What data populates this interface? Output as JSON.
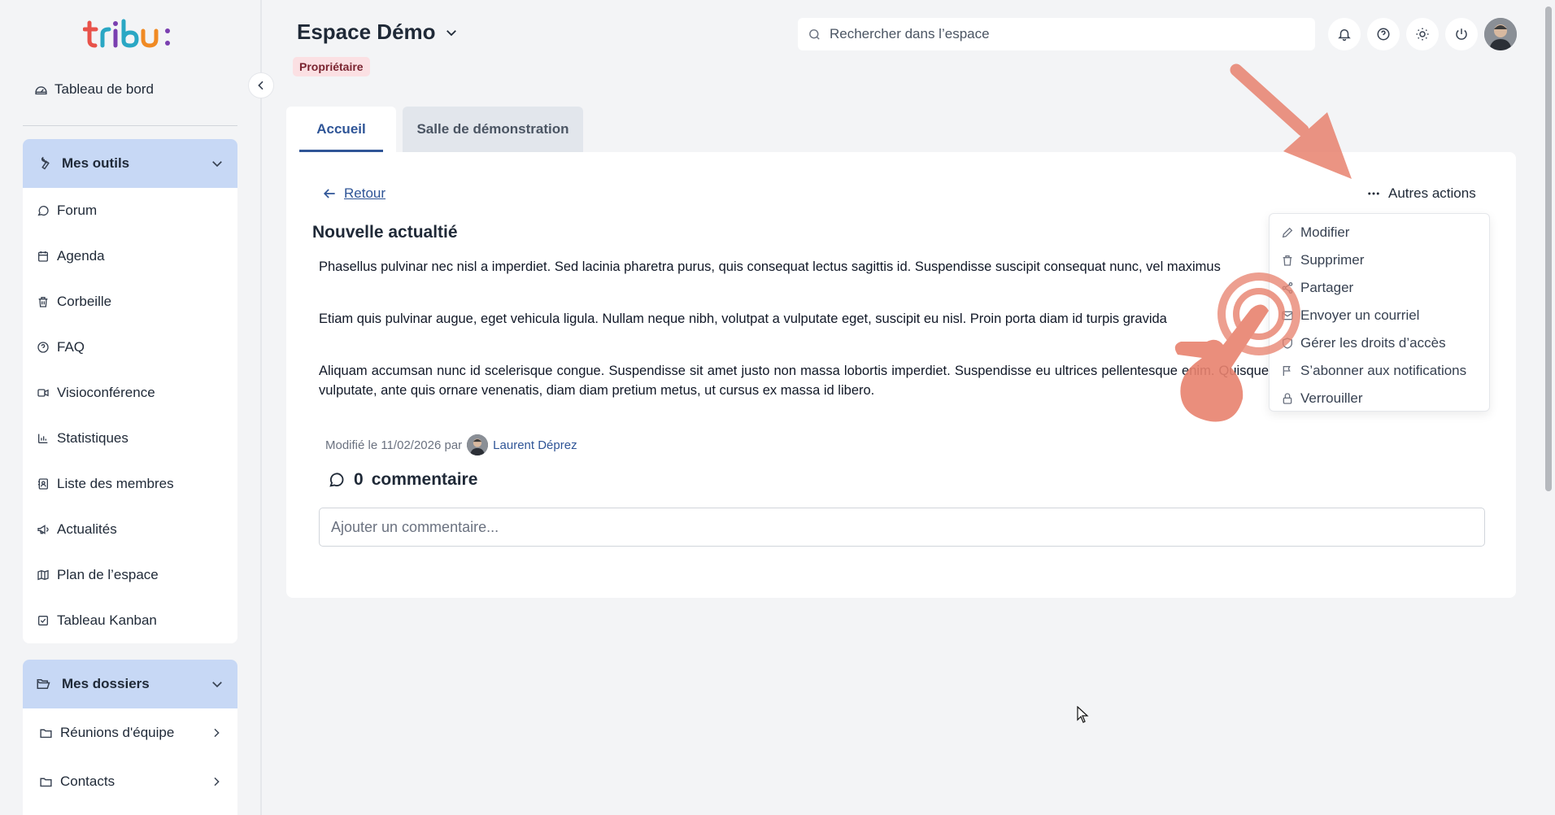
{
  "logo": {
    "text": "tribu :"
  },
  "sidebar": {
    "dashboard_label": "Tableau de bord",
    "tools_group": {
      "title": "Mes outils",
      "items": [
        {
          "label": "Forum",
          "icon": "chat-icon"
        },
        {
          "label": "Agenda",
          "icon": "calendar-icon"
        },
        {
          "label": "Corbeille",
          "icon": "trash-icon"
        },
        {
          "label": "FAQ",
          "icon": "help-circle-icon"
        },
        {
          "label": "Visioconférence",
          "icon": "video-icon"
        },
        {
          "label": "Statistiques",
          "icon": "bar-chart-icon"
        },
        {
          "label": "Liste des membres",
          "icon": "contacts-icon"
        },
        {
          "label": "Actualités",
          "icon": "megaphone-icon"
        },
        {
          "label": "Plan de l’espace",
          "icon": "map-icon"
        },
        {
          "label": "Tableau Kanban",
          "icon": "checkbox-icon"
        }
      ]
    },
    "folders_group": {
      "title": "Mes dossiers",
      "items": [
        {
          "label": "Réunions d'équipe",
          "icon": "folder-icon"
        },
        {
          "label": "Contacts",
          "icon": "folder-icon"
        }
      ]
    }
  },
  "header": {
    "space_title": "Espace Démo",
    "role_badge": "Propriétaire",
    "search_placeholder": "Rechercher dans l’espace"
  },
  "tabs": [
    {
      "label": "Accueil",
      "active": true
    },
    {
      "label": "Salle de démonstration",
      "active": false
    }
  ],
  "article": {
    "back_label": "Retour",
    "title": "Nouvelle actualtié",
    "paragraphs": [
      "Phasellus pulvinar nec nisl a imperdiet. Sed lacinia pharetra purus, quis consequat lectus sagittis id. Suspendisse suscipit consequat nunc, vel maximus",
      "Etiam quis pulvinar augue, eget vehicula ligula. Nullam neque nibh, volutpat a vulputate eget, suscipit eu nisl. Proin porta diam id turpis gravida",
      "Aliquam accumsan nunc id scelerisque congue. Suspendisse sit amet justo non massa lobortis imperdiet. Suspendisse eu ultrices pellentesque enim. Quisque vulputate, ante quis ornare venenatis, diam diam pretium metus, ut cursus ex massa id libero."
    ],
    "modified_prefix": "Modifié le 11/02/2026 par",
    "author": "Laurent Déprez",
    "comment_count": "0",
    "comment_word": "commentaire",
    "comment_placeholder": "Ajouter un commentaire..."
  },
  "actions": {
    "label": "Autres actions",
    "items": [
      {
        "label": "Modifier",
        "icon": "pencil-icon"
      },
      {
        "label": "Supprimer",
        "icon": "trash-icon"
      },
      {
        "label": "Partager",
        "icon": "share-icon"
      },
      {
        "label": "Envoyer un courriel",
        "icon": "mail-icon"
      },
      {
        "label": "Gérer les droits d’accès",
        "icon": "shield-icon"
      },
      {
        "label": "S’abonner aux notifications",
        "icon": "flag-icon"
      },
      {
        "label": "Verrouiller",
        "icon": "lock-icon"
      }
    ]
  },
  "colors": {
    "accent": "#2f5597",
    "group_header": "#c7d8f5",
    "badge_bg": "#fbe0e3",
    "annotation": "#e8826e"
  }
}
